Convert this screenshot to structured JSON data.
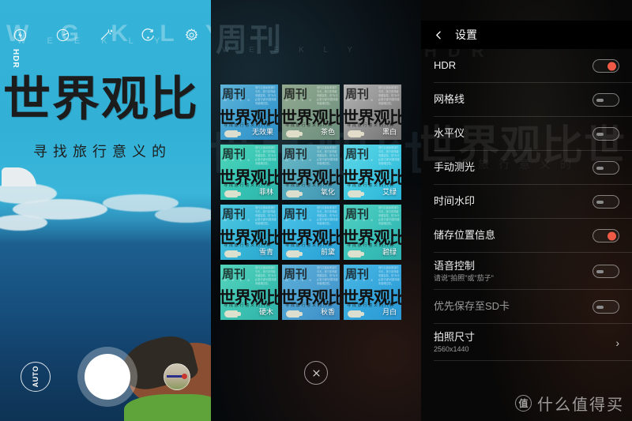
{
  "camera": {
    "toolbar": [
      {
        "name": "flash-icon",
        "label": "flash"
      },
      {
        "name": "filter-icon",
        "label": "filter"
      },
      {
        "name": "beauty-wand-icon",
        "label": "beauty"
      },
      {
        "name": "switch-camera-icon",
        "label": "switch"
      },
      {
        "name": "settings-gear-icon",
        "label": "settings"
      }
    ],
    "hdr_badge": "HDR",
    "mode_label": "AUTO",
    "poster": {
      "ghost_title": "W  G  K  L  Y",
      "ghost_sub": "W E E K L Y",
      "title": "世界观比",
      "subtitle": "寻找旅行意义的"
    },
    "shutter_name": "shutter-button",
    "thumbnail_name": "gallery-thumbnail"
  },
  "filters": {
    "ghost_title": "周刊",
    "ghost_sub": "W E E K L Y",
    "ghost_big": "世界观比世",
    "close_label": "✕",
    "cell_common": {
      "top": "周刊",
      "top_sub": "W E E K L Y",
      "right_text": "现代交通最便捷的今天，旅行变得越来越容易，但“为什么旅行”的问题却越来越难回答。",
      "main": "世界观比世",
      "subtitle": "寻找旅行意义的八种"
    },
    "items": [
      {
        "label": "无效果",
        "selected": true,
        "css": "linear-gradient(135deg,#5fb4d8 0%,#3f9fd0 55%,#2f8fc6 100%)"
      },
      {
        "label": "茶色",
        "selected": false,
        "css": "linear-gradient(135deg,#93a98f 0%,#7d9b86 55%,#6c8d7c 100%)"
      },
      {
        "label": "黑白",
        "selected": false,
        "css": "linear-gradient(135deg,#b4b4b4 0%,#8f8f8f 55%,#6f6f6f 100%)"
      },
      {
        "label": "菲林",
        "selected": false,
        "css": "linear-gradient(135deg,#4fd6b8 0%,#35c4b4 55%,#2db2a8 100%)"
      },
      {
        "label": "氧化",
        "selected": false,
        "css": "linear-gradient(135deg,#6fb9c4 0%,#4fa6bc 55%,#3f93b0 100%)"
      },
      {
        "label": "艾绿",
        "selected": false,
        "css": "linear-gradient(135deg,#5fd8e8 0%,#3ec6e0 55%,#2bb2d6 100%)"
      },
      {
        "label": "雪青",
        "selected": false,
        "css": "linear-gradient(135deg,#4fc8e0 0%,#36b6d8 55%,#2aa4cc 100%)"
      },
      {
        "label": "前黛",
        "selected": false,
        "css": "linear-gradient(135deg,#4ec4e6 0%,#35b0de 55%,#2a9ed4 100%)"
      },
      {
        "label": "碧绿",
        "selected": false,
        "css": "linear-gradient(135deg,#52d0c0 0%,#3ac0b8 55%,#2fb0ae 100%)"
      },
      {
        "label": "硬木",
        "selected": false,
        "css": "linear-gradient(135deg,#56d4bc 0%,#3cc2b2 55%,#2fb0a8 100%)"
      },
      {
        "label": "秋香",
        "selected": false,
        "css": "linear-gradient(135deg,#5fb0d8 0%,#4a9ed0 55%,#3a8ec6 100%)"
      },
      {
        "label": "月白",
        "selected": false,
        "css": "linear-gradient(135deg,#4ab8e4 0%,#35a6dc 55%,#2a96d2 100%)"
      }
    ]
  },
  "settings": {
    "ghost1": "HDR",
    "ghost2": "世界观比世",
    "ghost3": "寻找旅行意义的",
    "header": {
      "back_name": "back-button",
      "title": "设置"
    },
    "rows": [
      {
        "label": "HDR",
        "sub": "",
        "control": "toggle",
        "state": "on"
      },
      {
        "label": "网格线",
        "sub": "",
        "control": "toggle",
        "state": "off"
      },
      {
        "label": "水平仪",
        "sub": "",
        "control": "toggle",
        "state": "off"
      },
      {
        "label": "手动测光",
        "sub": "",
        "control": "toggle",
        "state": "off"
      },
      {
        "label": "时间水印",
        "sub": "",
        "control": "toggle",
        "state": "off"
      },
      {
        "label": "储存位置信息",
        "sub": "",
        "control": "toggle",
        "state": "on"
      },
      {
        "label": "语音控制",
        "sub": "请说\"拍照\"或\"茄子\"",
        "control": "toggle",
        "state": "off"
      },
      {
        "label": "优先保存至SD卡",
        "sub": "",
        "control": "toggle",
        "state": "off",
        "dim": true
      },
      {
        "label": "拍照尺寸",
        "sub": "2560x1440",
        "control": "chevron",
        "state": ""
      }
    ],
    "chevron_glyph": "›"
  },
  "watermark": {
    "badge": "值",
    "text": "什么值得买"
  },
  "colors": {
    "toggle_on": "#ef5a47",
    "toggle_off": "#8b8b8b",
    "selected_outline": "#7fd0ef"
  }
}
